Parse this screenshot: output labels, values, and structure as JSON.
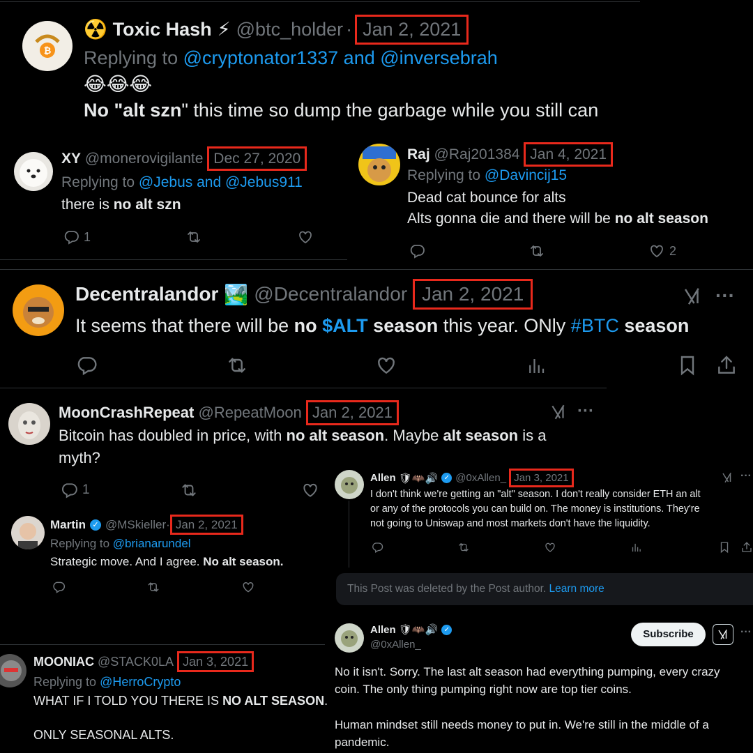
{
  "t1": {
    "name": "Toxic Hash",
    "name_emoji_left": "☢️",
    "name_emoji_right": "⚡",
    "handle": "@btc_holder",
    "sep": "·",
    "date": "Jan 2, 2021",
    "replying_prefix": "Replying to",
    "reply_a": "@cryptonator1337",
    "reply_and": "and",
    "reply_b": "@inversebrah",
    "emojis": "😂😂😂",
    "text_1": "No \"",
    "text_b1": "alt szn",
    "text_2": "\" this time so dump the garbage while you still can"
  },
  "t2": {
    "name": "XY",
    "handle": "@monerovigilante",
    "date": "Dec 27, 2020",
    "replying_prefix": "Replying to",
    "replying_to": "@Jebus and @Jebus911",
    "text_1": "there is ",
    "text_b1": "no alt szn",
    "reply_count": "1"
  },
  "t3": {
    "name": "Raj",
    "handle": "@Raj201384",
    "date": "Jan 4, 2021",
    "replying_prefix": "Replying to",
    "replying_to": "@Davincij15",
    "line1": "Dead cat bounce for alts",
    "line2_a": "Alts gonna die and there will be ",
    "line2_b": "no alt season",
    "like_count": "2"
  },
  "t4": {
    "name": "Decentralandor",
    "name_emoji": "🏞️",
    "handle": "@Decentralandor",
    "date": "Jan 2, 2021",
    "t_a": "It seems that there will be ",
    "t_b1": "no",
    "t_sp1": " ",
    "t_cash": "$ALT",
    "t_sp2": " ",
    "t_b2": "season",
    "t_c": " this year. ONly ",
    "t_hash": "#BTC",
    "t_sp3": " ",
    "t_b3": "season",
    "more": "···"
  },
  "t5": {
    "name": "MoonCrashRepeat",
    "handle": "@RepeatMoon",
    "date": "Jan 2, 2021",
    "text_a": "Bitcoin has doubled in price, with ",
    "text_b1": "no alt season",
    "text_c": ". Maybe ",
    "text_b2": "alt season",
    "text_d": " is a",
    "text_e": "myth?",
    "reply_count": "1",
    "more": "···"
  },
  "t6": {
    "name": "Allen",
    "name_emojis": "🛡🦇🔊",
    "handle": "@0xAllen_",
    "date": "Jan 3, 2021",
    "line1": "I don't think we're getting an \"alt\" season. I don't really consider ETH an alt",
    "line2": "or any of the protocols you can build on. The money is institutions. They're",
    "line3": "not going to Uniswap and most markets don't have the liquidity.",
    "more": "···"
  },
  "t7": {
    "name": "Martin",
    "handle": "@MSkieller",
    "sep": "·",
    "date": "Jan 2, 2021",
    "replying_prefix": "Replying to",
    "replying_to": "@brianarundel",
    "text_a": "Strategic move. And I agree. ",
    "text_b": "No alt season."
  },
  "deleted": {
    "text": "This Post was deleted by the Post author.",
    "link": "Learn more"
  },
  "t8": {
    "name": "Allen",
    "name_emojis": "🛡🦇🔊",
    "handle": "@0xAllen_",
    "subscribe": "Subscribe",
    "more": "···",
    "p1_l1": "No it isn't. Sorry. The last alt season had everything pumping, every crazy",
    "p1_l2": "coin. The only thing pumping right now are top tier coins.",
    "p2_l1": "Human mindset still needs money to put in. We're still in the middle of a",
    "p2_l2": "pandemic."
  },
  "t9": {
    "name": "MOONIAC",
    "handle": "@STACK0LA",
    "date": "Jan 3, 2021",
    "replying_prefix": "Replying to",
    "replying_to": "@HerroCrypto",
    "line1_a": "WHAT IF I TOLD YOU THERE IS ",
    "line1_b": "NO ALT SEASON",
    "line1_c": ".",
    "line2": "ONLY SEASONAL ALTS."
  },
  "colors": {
    "background": "#000000",
    "text": "#e7e9ea",
    "secondary": "#71767b",
    "link": "#1d9bf0",
    "highlight_box": "#e8291c",
    "divider": "#2f3336"
  }
}
